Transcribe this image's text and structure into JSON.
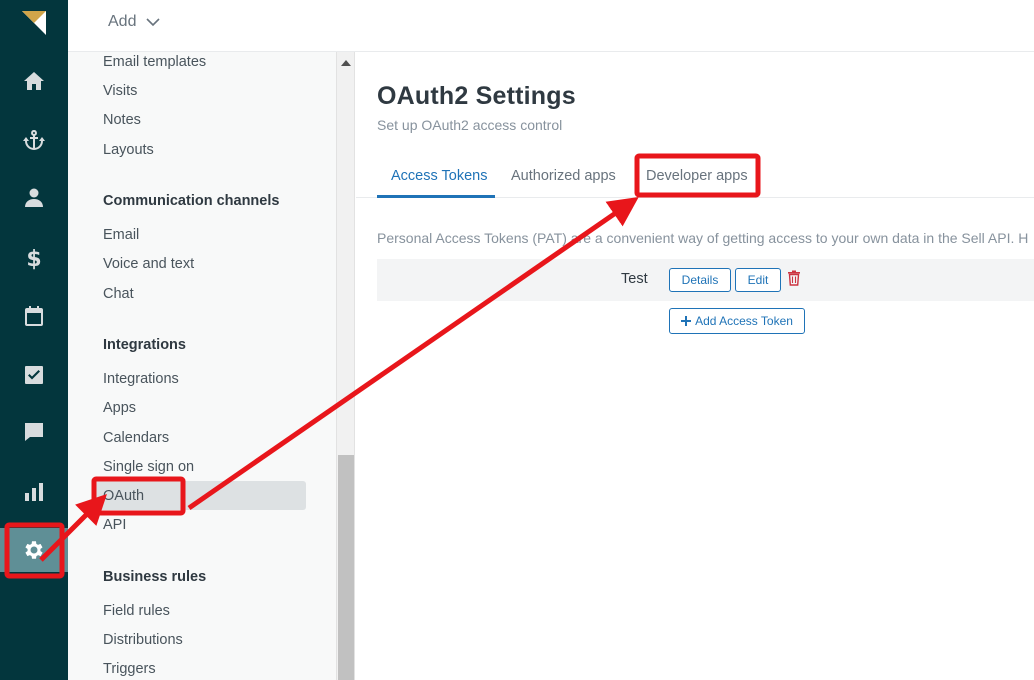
{
  "header": {
    "add_label": "Add"
  },
  "rail": {
    "items": [
      {
        "icon": "home-icon"
      },
      {
        "icon": "leads-icon"
      },
      {
        "icon": "contacts-icon"
      },
      {
        "icon": "deals-icon"
      },
      {
        "icon": "calendar-icon"
      },
      {
        "icon": "tasks-icon"
      },
      {
        "icon": "communication-icon"
      },
      {
        "icon": "reports-icon"
      },
      {
        "icon": "settings-icon",
        "active": true
      }
    ]
  },
  "sidebar": {
    "items_top": [
      "Email templates",
      "Visits",
      "Notes",
      "Layouts"
    ],
    "communication_heading": "Communication channels",
    "communication_items": [
      "Email",
      "Voice and text",
      "Chat"
    ],
    "integrations_heading": "Integrations",
    "integrations_items": [
      "Integrations",
      "Apps",
      "Calendars",
      "Single sign on",
      "OAuth",
      "API"
    ],
    "selected": "OAuth",
    "business_heading": "Business rules",
    "business_items": [
      "Field rules",
      "Distributions",
      "Triggers"
    ]
  },
  "main": {
    "title": "OAuth2 Settings",
    "subtitle": "Set up OAuth2 access control",
    "tabs": [
      {
        "label": "Access Tokens",
        "active": true
      },
      {
        "label": "Authorized apps"
      },
      {
        "label": "Developer apps"
      }
    ],
    "description": "Personal Access Tokens (PAT) are a convenient way of getting access to your own data in the Sell API. H",
    "tokens": [
      {
        "name": "Test",
        "details_label": "Details",
        "edit_label": "Edit"
      }
    ],
    "add_token_label": "Add Access Token"
  },
  "colors": {
    "rail_bg": "#03363d",
    "rail_active": "#5f8f96",
    "accent": "#1f73b7",
    "annotation_red": "#e8161b",
    "delete_red": "#cc3340"
  }
}
